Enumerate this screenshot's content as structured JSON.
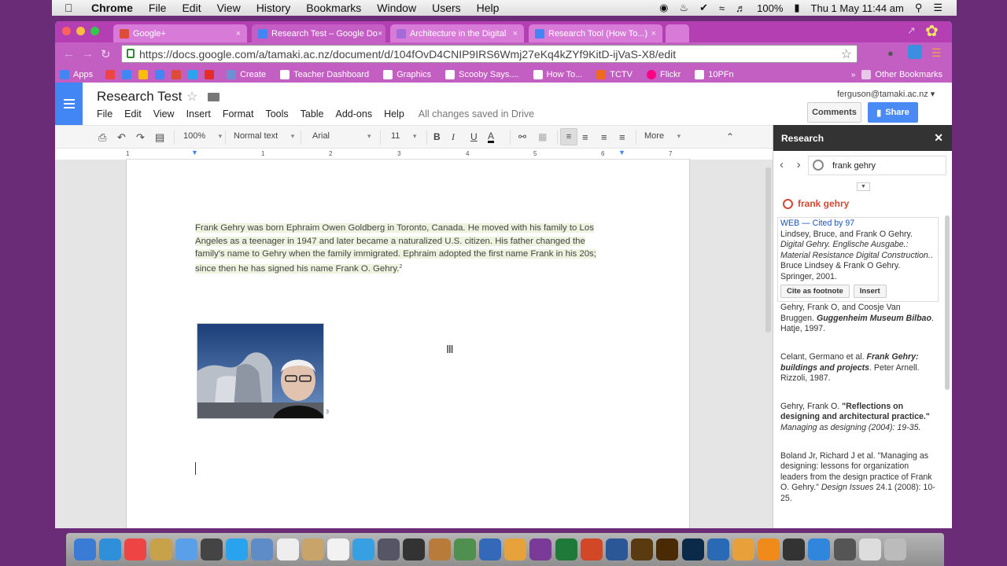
{
  "menubar": {
    "app": "Chrome",
    "items": [
      "File",
      "Edit",
      "View",
      "History",
      "Bookmarks",
      "Window",
      "Users",
      "Help"
    ],
    "battery": "100%",
    "clock": "Thu 1 May  11:44 am"
  },
  "tabs": [
    {
      "label": "Google+",
      "color": "#dd4b39"
    },
    {
      "label": "Research Test – Google Do",
      "color": "#4285f4"
    },
    {
      "label": "Architecture in the Digital",
      "color": "#a569d8"
    },
    {
      "label": "Research Tool (How To...)",
      "color": "#4285f4"
    }
  ],
  "address": {
    "url": "https://docs.google.com/a/tamaki.ac.nz/document/d/104fOvD4CNIP9IRS6Wmj27eKq4kZYf9KitD-ijVaS-X8/edit"
  },
  "bookmarks": [
    {
      "label": "Apps",
      "color": "#4285f4"
    },
    {
      "label": "Create",
      "color": "#6d8fd4"
    },
    {
      "label": "Teacher Dashboard",
      "color": "#ffffff"
    },
    {
      "label": "Graphics",
      "color": "#ffffff"
    },
    {
      "label": "Scooby Says....",
      "color": "#ffffff"
    },
    {
      "label": "How To...",
      "color": "#ffffff"
    },
    {
      "label": "TCTV",
      "color": "#f06a1d"
    },
    {
      "label": "Flickr",
      "color": "#ff0084"
    },
    {
      "label": "10PFn",
      "color": "#ffffff"
    }
  ],
  "other_bookmarks": "Other Bookmarks",
  "doc": {
    "title": "Research Test",
    "menu": [
      "File",
      "Edit",
      "View",
      "Insert",
      "Format",
      "Tools",
      "Table",
      "Add-ons",
      "Help"
    ],
    "save_status": "All changes saved in Drive",
    "user": "ferguson@tamaki.ac.nz",
    "comments": "Comments",
    "share": "Share",
    "paragraph": "Frank Gehry was born Ephraim Owen Goldberg in Toronto, Canada. He moved with his family to Los Angeles as a teenager in 1947 and later became a naturalized U.S. citizen. His father changed the family's name to Gehry when the family immigrated. Ephraim adopted the first name Frank in his 20s; since then he has signed his name Frank O. Gehry.",
    "footnote_ref": "2",
    "image_footnote": "3"
  },
  "format_toolbar": {
    "zoom": "100%",
    "style": "Normal text",
    "font": "Arial",
    "size": "11",
    "more": "More"
  },
  "ruler": [
    "1",
    "1",
    "2",
    "3",
    "4",
    "5",
    "6",
    "7"
  ],
  "research": {
    "header": "Research",
    "query": "frank gehry",
    "result_title": "frank gehry",
    "card": {
      "source": "WEB — Cited by 97",
      "text1": "Lindsey, Bruce, and Frank O Gehry.",
      "italic": "Digital Gehry. Englische Ausgabe.: Material Resistance Digital Construction.",
      "text2": ". Bruce Lindsey & Frank O Gehry. Springer, 2001.",
      "cite_btn": "Cite as footnote",
      "insert_btn": "Insert"
    },
    "results": [
      {
        "pre": "Gehry, Frank O, and Coosje Van Bruggen.",
        "em": "Guggenheim Museum Bilbao",
        "post": ". Hatje, 1997."
      },
      {
        "pre": "Celant, Germano et al.",
        "em": "Frank Gehry: buildings and projects",
        "post": ". Peter Arnell. Rizzoli, 1987."
      },
      {
        "pre": "Gehry, Frank O.",
        "em": "\"Reflections on designing and architectural practice.\"",
        "post": "Managing as designing (2004): 19-35."
      },
      {
        "pre": "Boland Jr, Richard J et al. \"Managing as designing: lessons for organization leaders from the design practice of Frank O. Gehry.\"",
        "em": "Design Issues",
        "post": "24.1 (2008): 10-25."
      }
    ]
  },
  "dock": [
    {
      "icon": "finder-icon",
      "color": "#3a7bd5"
    },
    {
      "icon": "safari-icon",
      "color": "#2f8fd8"
    },
    {
      "icon": "chrome-icon",
      "color": "#e44"
    },
    {
      "icon": "preview-icon",
      "color": "#c8a24a"
    },
    {
      "icon": "messages-icon",
      "color": "#5aa0e8"
    },
    {
      "icon": "facetime-icon",
      "color": "#444"
    },
    {
      "icon": "twitter-icon",
      "color": "#2aa3ef"
    },
    {
      "icon": "mail-icon",
      "color": "#5d8cc7"
    },
    {
      "icon": "notes-icon",
      "color": "#eee"
    },
    {
      "icon": "contacts-icon",
      "color": "#c9a46a"
    },
    {
      "icon": "calendar-icon",
      "color": "#f2f2f2"
    },
    {
      "icon": "itunes-icon",
      "color": "#37a0e3"
    },
    {
      "icon": "iphoto-icon",
      "color": "#556"
    },
    {
      "icon": "imovie-icon",
      "color": "#333"
    },
    {
      "icon": "garageband-icon",
      "color": "#b97b3a"
    },
    {
      "icon": "numbers-icon",
      "color": "#4f8f4f"
    },
    {
      "icon": "keynote-icon",
      "color": "#3468b8"
    },
    {
      "icon": "pages-icon",
      "color": "#e7a23c"
    },
    {
      "icon": "onenote-icon",
      "color": "#7a3a98"
    },
    {
      "icon": "excel-icon",
      "color": "#1f7a3a"
    },
    {
      "icon": "powerpoint-icon",
      "color": "#d24726"
    },
    {
      "icon": "word-icon",
      "color": "#2b5797"
    },
    {
      "icon": "bridge-icon",
      "color": "#5a3a10"
    },
    {
      "icon": "illustrator-icon",
      "color": "#4a2a05"
    },
    {
      "icon": "photoshop-icon",
      "color": "#0b2a4a"
    },
    {
      "icon": "quicktime-icon",
      "color": "#2a6ab5"
    },
    {
      "icon": "pencil-icon",
      "color": "#e8a03a"
    },
    {
      "icon": "ibooks-icon",
      "color": "#f08a1a"
    },
    {
      "icon": "kindle-icon",
      "color": "#333"
    },
    {
      "icon": "appstore-icon",
      "color": "#2f86dc"
    },
    {
      "icon": "screenshot-icon",
      "color": "#555"
    },
    {
      "icon": "acrobat-icon",
      "color": "#ddd"
    },
    {
      "icon": "trash-icon",
      "color": "#bbb"
    }
  ]
}
